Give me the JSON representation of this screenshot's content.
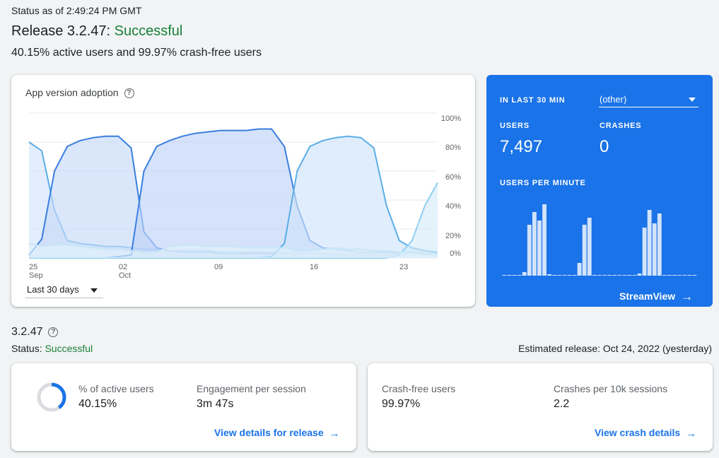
{
  "header": {
    "status_time": "Status as of 2:49:24 PM GMT",
    "release_prefix": "Release 3.2.47: ",
    "release_status": "Successful",
    "summary": "40.15% active users and 99.97% crash-free users"
  },
  "adoption": {
    "title": "App version adoption",
    "range": "Last 30 days",
    "chart_data": {
      "type": "area",
      "x_ticks": [
        "25\nSep",
        "02\nOct",
        "09",
        "16",
        "23"
      ],
      "y_ticks": [
        "100%",
        "80%",
        "60%",
        "40%",
        "20%",
        "0%"
      ],
      "ylim": [
        0,
        100
      ],
      "x": [
        0,
        1,
        2,
        3,
        4,
        5,
        6,
        7,
        8,
        9,
        10,
        11,
        12,
        13,
        14,
        15,
        16,
        17,
        18,
        19,
        20,
        21,
        22,
        23,
        24,
        25,
        26,
        27,
        28,
        29,
        30,
        31,
        32
      ],
      "series": [
        {
          "values": [
            80,
            74,
            33,
            12,
            10,
            9,
            8,
            8,
            7,
            6,
            6,
            5,
            5,
            5,
            5,
            4,
            4,
            4,
            4,
            4,
            4,
            4,
            3,
            3,
            3,
            3,
            3,
            3,
            3,
            3,
            3,
            3,
            3
          ]
        },
        {
          "values": [
            2,
            13,
            60,
            77,
            81,
            83,
            84,
            84,
            76,
            18,
            7,
            5,
            4,
            4,
            4,
            3,
            3,
            3,
            3,
            3,
            3,
            3,
            3,
            3,
            2,
            2,
            2,
            2,
            2,
            2,
            2,
            2,
            2
          ]
        },
        {
          "values": [
            0,
            0,
            0,
            0,
            0,
            0,
            0,
            1,
            2,
            60,
            77,
            81,
            84,
            86,
            87,
            88,
            88,
            88,
            89,
            89,
            77,
            36,
            12,
            7,
            6,
            5,
            4,
            4,
            4,
            3,
            3,
            3,
            3
          ]
        },
        {
          "values": [
            0,
            0,
            0,
            0,
            0,
            0,
            0,
            0,
            0,
            0,
            0,
            0,
            0,
            0,
            0,
            0,
            0,
            0,
            0,
            1,
            10,
            60,
            77,
            81,
            83,
            84,
            83,
            76,
            36,
            12,
            7,
            5,
            4
          ]
        },
        {
          "values": [
            0,
            0,
            0,
            0,
            0,
            0,
            0,
            0,
            0,
            0,
            0,
            0,
            0,
            0,
            0,
            0,
            0,
            0,
            0,
            0,
            0,
            0,
            0,
            0,
            0,
            0,
            0,
            0,
            0,
            2,
            12,
            36,
            52
          ]
        },
        {
          "values": [
            10,
            8,
            9,
            9,
            8,
            7,
            6,
            6,
            5,
            4,
            4,
            8,
            9,
            9,
            8,
            8,
            8,
            7,
            7,
            7,
            7,
            5,
            5,
            6,
            7,
            6,
            6,
            5,
            5,
            4,
            4,
            3,
            3
          ]
        }
      ]
    }
  },
  "realtime": {
    "label_last": "IN LAST 30 MIN",
    "version_select": "(other)",
    "users_label": "USERS",
    "users_value": "7,497",
    "crashes_label": "CRASHES",
    "crashes_value": "0",
    "upm_label": "USERS PER MINUTE",
    "upm_values": [
      1,
      1,
      1,
      1,
      5,
      72,
      90,
      78,
      101,
      2,
      1,
      1,
      1,
      1,
      1,
      18,
      72,
      82,
      1,
      1,
      1,
      1,
      1,
      1,
      1,
      1,
      1,
      3,
      68,
      93,
      74,
      88,
      1,
      1,
      1,
      1,
      1,
      1,
      1
    ],
    "streamview": "StreamView"
  },
  "version": {
    "title": "3.2.47",
    "status_prefix": "Status: ",
    "status": "Successful",
    "estimated": "Estimated release: Oct 24, 2022 (yesterday)"
  },
  "metrics": {
    "active_users_label": "% of active users",
    "active_users_value": "40.15%",
    "active_users_fraction": 0.4015,
    "engagement_label": "Engagement per session",
    "engagement_value": "3m 47s",
    "view_release": "View details for release",
    "crash_free_label": "Crash-free users",
    "crash_free_value": "99.97%",
    "crashes_10k_label": "Crashes per 10k sessions",
    "crashes_10k_value": "2.2",
    "view_crash": "View crash details"
  },
  "colors": {
    "success": "#188038",
    "accent": "#1a73e8"
  }
}
